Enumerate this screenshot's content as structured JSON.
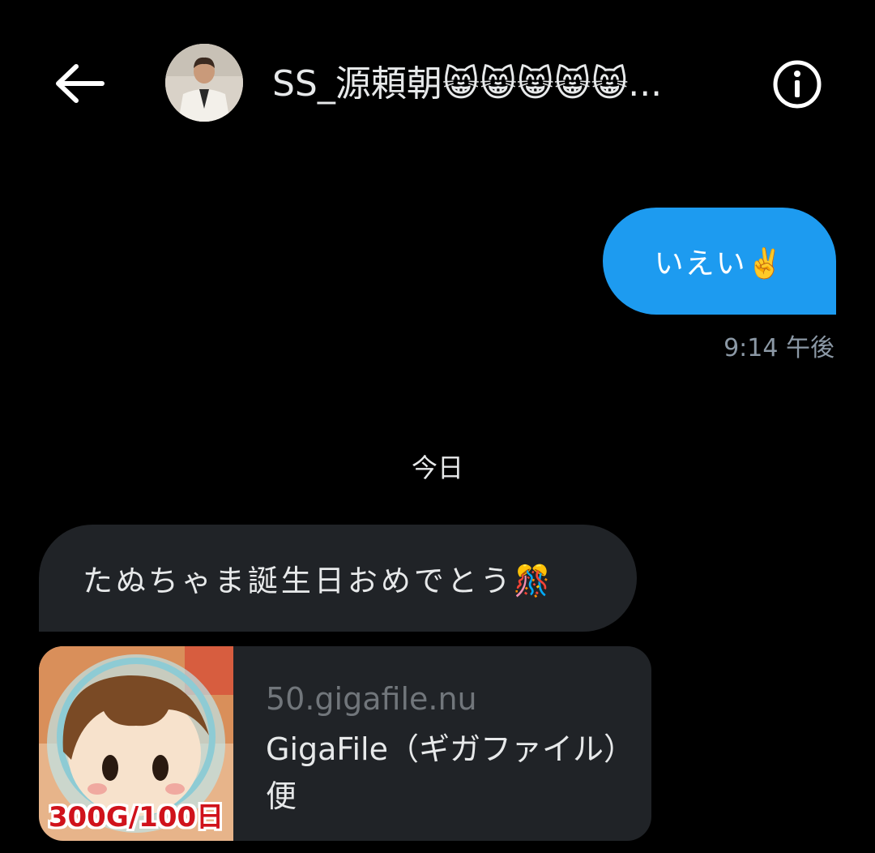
{
  "header": {
    "title": "SS_源頼朝😸😸😸😸😸...",
    "back_icon": "arrow-left-icon",
    "info_icon": "info-icon"
  },
  "messages": {
    "outgoing_text": "いえい✌️",
    "outgoing_time": "9:14 午後",
    "date_separator": "今日",
    "incoming_text": "たぬちゃま誕生日おめでとう🎊"
  },
  "link_card": {
    "badge": "300G/100日",
    "domain": "50.gigafile.nu",
    "title": "GigaFile（ギガファイル）便"
  },
  "colors": {
    "background": "#000000",
    "outgoing_bubble": "#1d9bf0",
    "incoming_bubble": "#202327",
    "muted_text": "#71767b"
  }
}
